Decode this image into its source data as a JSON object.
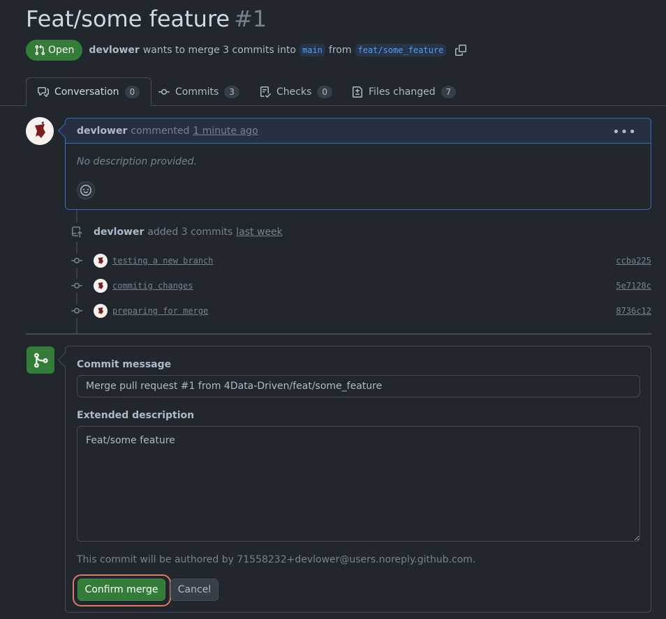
{
  "pr": {
    "title": "Feat/some feature",
    "number": "#1",
    "state": "Open",
    "author": "devlower",
    "merge_text_1": "wants to merge 3 commits into",
    "base_branch": "main",
    "from_text": "from",
    "head_branch": "feat/some_feature"
  },
  "tabs": [
    {
      "label": "Conversation",
      "count": "0",
      "icon": "comment-discussion-icon"
    },
    {
      "label": "Commits",
      "count": "3",
      "icon": "git-commit-icon"
    },
    {
      "label": "Checks",
      "count": "0",
      "icon": "checklist-icon"
    },
    {
      "label": "Files changed",
      "count": "7",
      "icon": "file-diff-icon"
    }
  ],
  "comment": {
    "author": "devlower",
    "action": "commented",
    "time": "1 minute ago",
    "body": "No description provided."
  },
  "push_event": {
    "author": "devlower",
    "action": "added 3 commits",
    "time": "last week"
  },
  "commits": [
    {
      "message": "testing a new branch",
      "sha": "ccba225"
    },
    {
      "message": "commitig changes",
      "sha": "5e7128c"
    },
    {
      "message": "preparing for merge",
      "sha": "8736c12"
    }
  ],
  "merge": {
    "commit_message_label": "Commit message",
    "commit_message": "Merge pull request #1 from 4Data-Driven/feat/some_feature",
    "extended_label": "Extended description",
    "extended_value": "Feat/some feature",
    "author_note": "This commit will be authored by 71558232+devlower@users.noreply.github.com.",
    "confirm_label": "Confirm merge",
    "cancel_label": "Cancel"
  },
  "colors": {
    "background": "#22272e",
    "accent_green": "#347d39",
    "accent_blue": "#316dca",
    "highlight": "#d97b68"
  }
}
